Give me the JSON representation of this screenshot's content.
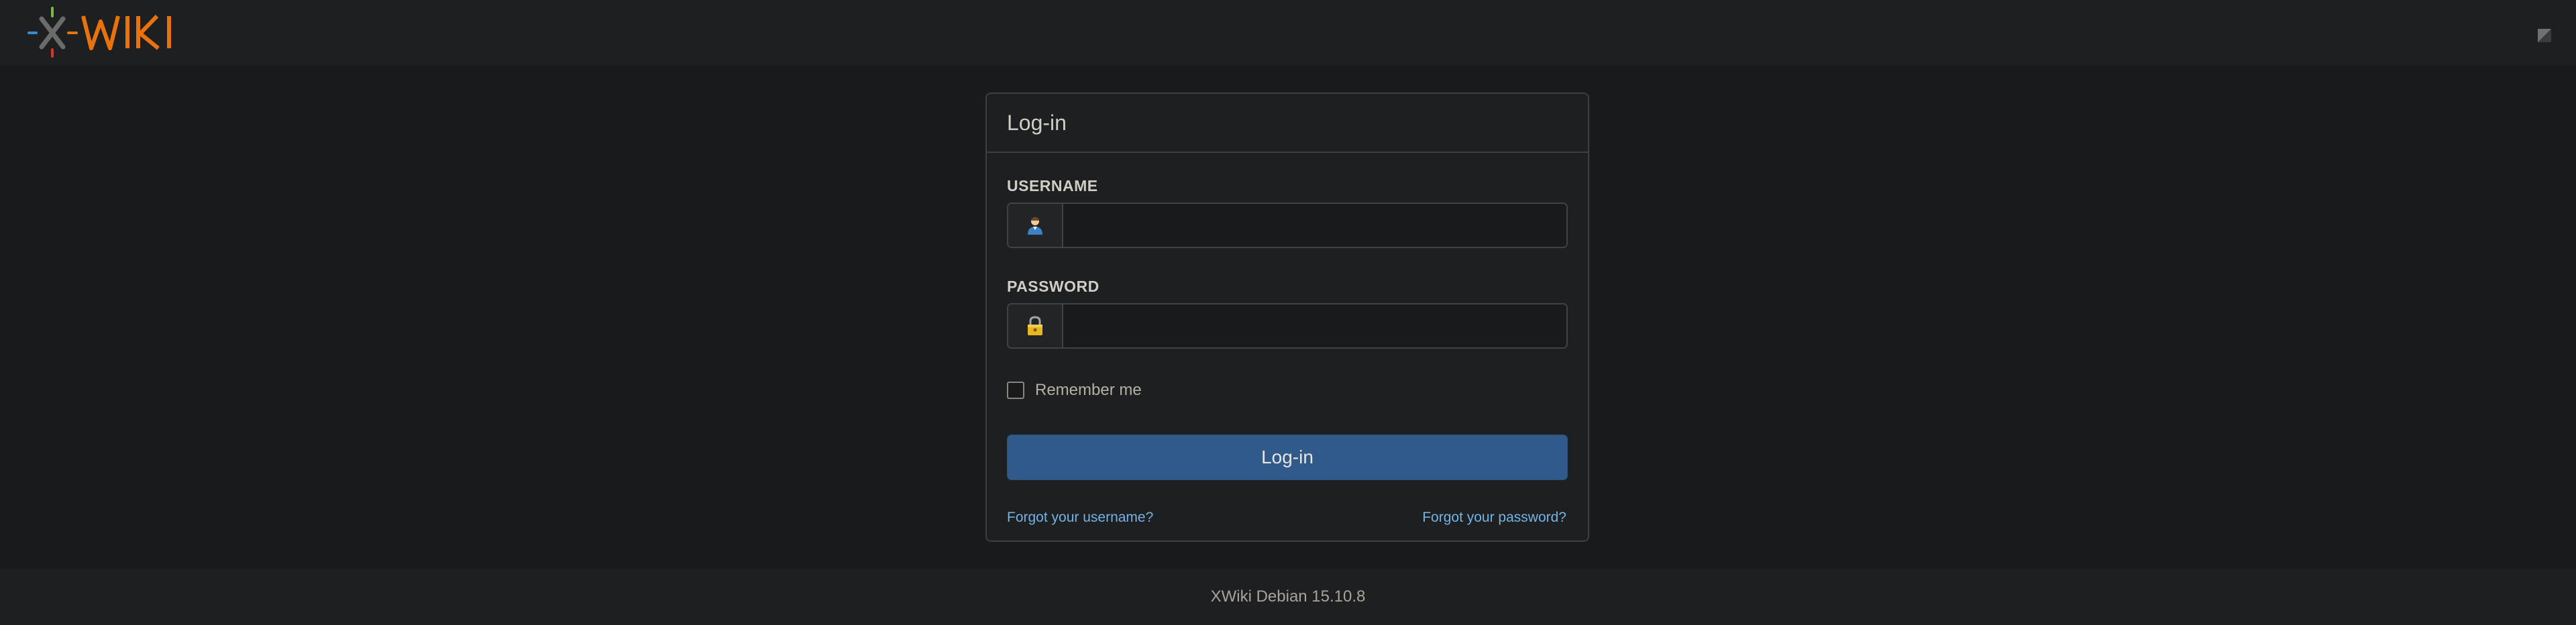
{
  "header": {
    "logo_text": "XWIKI",
    "menu_icon": "menu-square-icon"
  },
  "login": {
    "title": "Log-in",
    "username_label": "USERNAME",
    "username_value": "",
    "username_icon": "user-icon",
    "password_label": "PASSWORD",
    "password_value": "",
    "password_icon": "lock-icon",
    "remember_label": "Remember me",
    "remember_checked": false,
    "submit_label": "Log-in",
    "forgot_username": "Forgot your username?",
    "forgot_password": "Forgot your password?"
  },
  "footer": {
    "version": "XWiki Debian 15.10.8"
  },
  "colors": {
    "background": "#181a1b",
    "panel": "#1d1f20",
    "primary_button": "#2f5a8a",
    "link": "#74b3e6",
    "logo_orange": "#e8720c"
  }
}
